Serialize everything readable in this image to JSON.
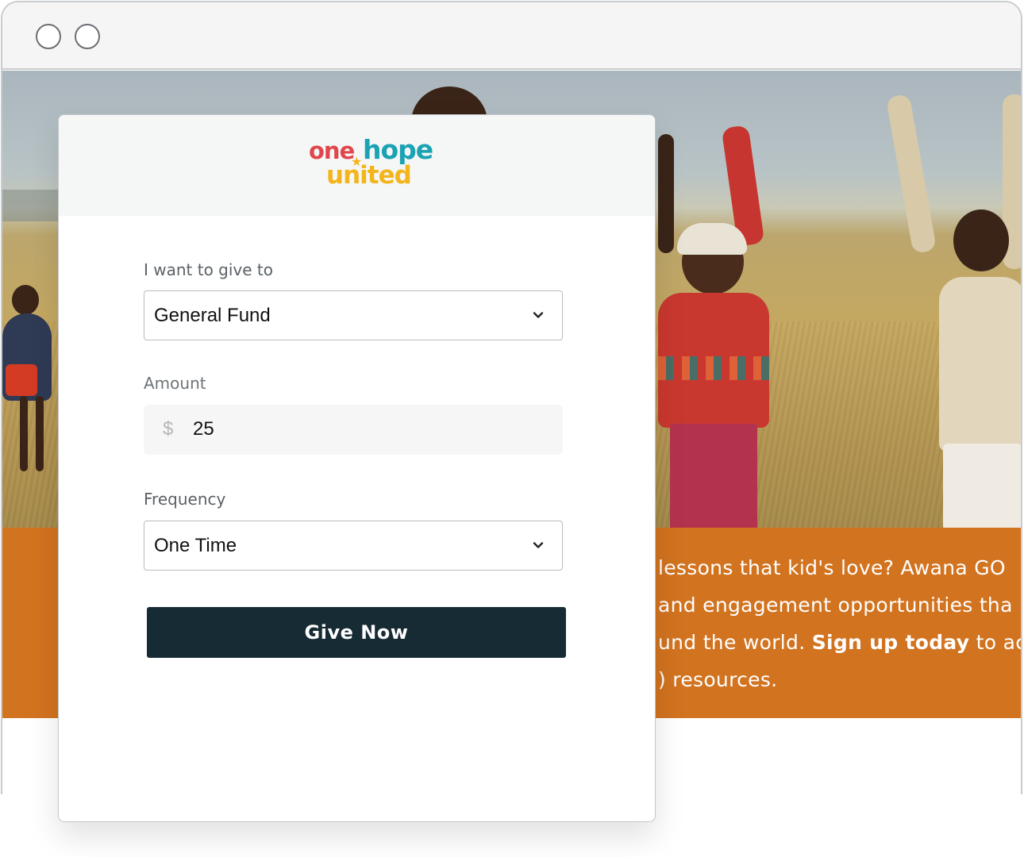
{
  "form": {
    "logo": {
      "word1": "one",
      "word2": "hope",
      "word3": "united",
      "tm": "™",
      "star": "★"
    },
    "give_to_label": "I want to give to",
    "give_to_value": "General Fund",
    "amount_label": "Amount",
    "currency_symbol": "$",
    "amount_value": "25",
    "frequency_label": "Frequency",
    "frequency_value": "One Time",
    "submit_label": "Give Now"
  },
  "banner": {
    "line1": "lessons that kid's love? Awana GO",
    "line2": "and engagement opportunities tha",
    "line3_pre": "und the world. ",
    "line3_bold": "Sign up today",
    "line3_post": " to acc",
    "line4": ") resources."
  },
  "colors": {
    "accent_orange": "#d2731f",
    "button_dark": "#172b35",
    "logo_red": "#e0474c",
    "logo_teal": "#1ba3b3",
    "logo_yellow": "#f3b51b"
  }
}
